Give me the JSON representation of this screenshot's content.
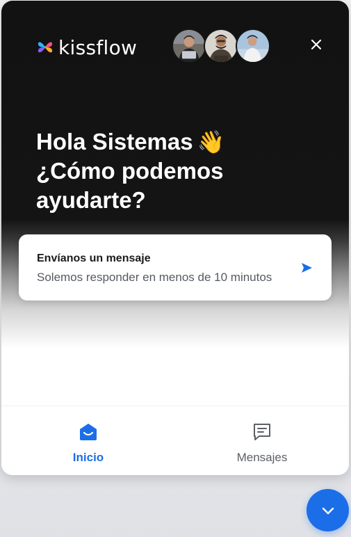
{
  "brand": {
    "name": "kissflow",
    "logo_icon": "butterfly-logo-icon"
  },
  "header": {
    "avatars": [
      "avatar-1",
      "avatar-2",
      "avatar-3"
    ],
    "close_icon": "close-icon"
  },
  "greeting": {
    "line1": "Hola Sistemas",
    "emoji": "👋",
    "line2": "¿Cómo podemos",
    "line3": "ayudarte?"
  },
  "message_card": {
    "title": "Envíanos un mensaje",
    "subtitle": "Solemos responder en menos de 10 minutos",
    "icon": "send-icon"
  },
  "tabs": [
    {
      "label": "Inicio",
      "icon": "home-icon",
      "active": true
    },
    {
      "label": "Mensajes",
      "icon": "messages-icon",
      "active": false
    }
  ],
  "launcher": {
    "icon": "chevron-down-icon"
  },
  "colors": {
    "accent": "#1c6ee8",
    "hero_bg": "#121212",
    "text_dark": "#1a1a1a",
    "text_muted": "#555a62"
  }
}
